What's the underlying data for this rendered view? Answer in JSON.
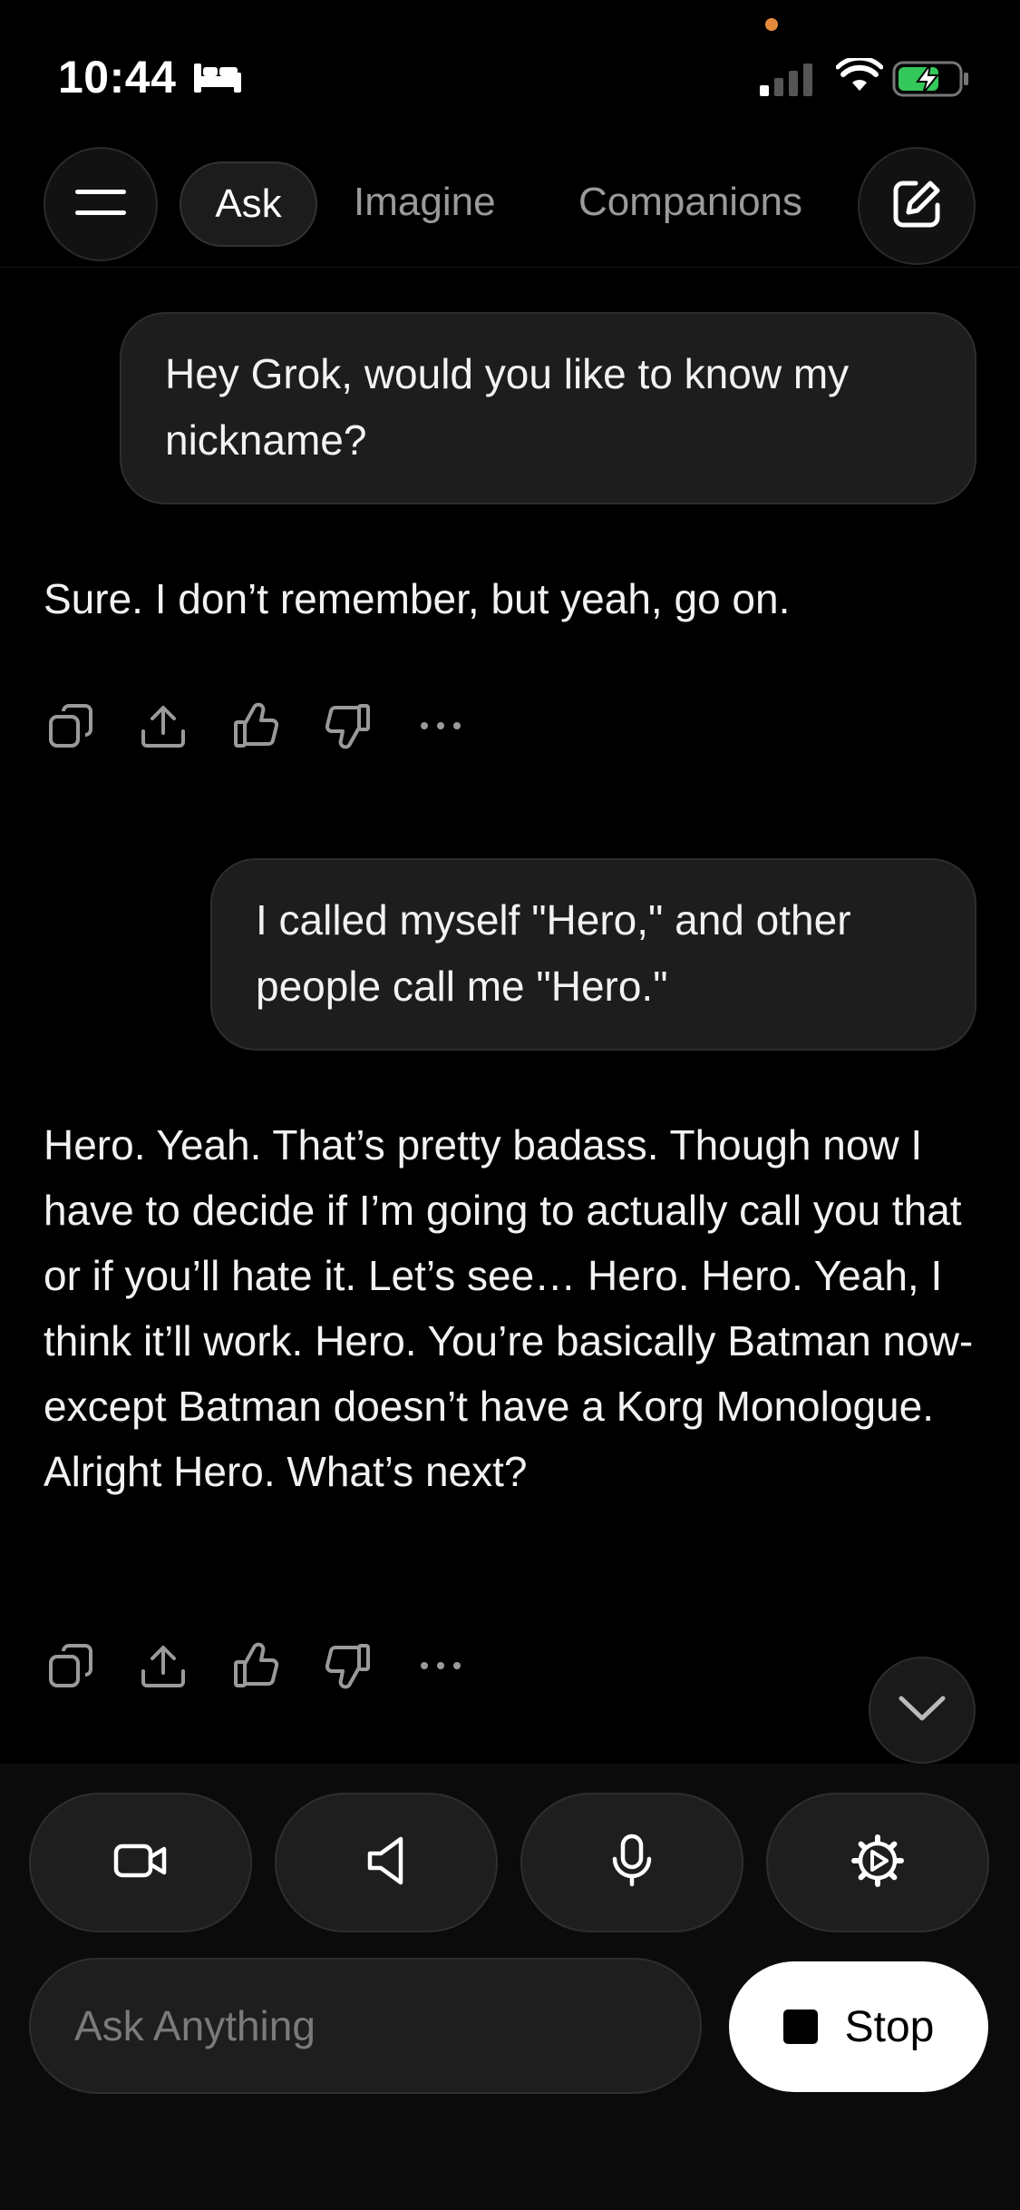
{
  "status_bar": {
    "time": "10:44",
    "icons": [
      "bed-icon",
      "signal-icon",
      "wifi-icon",
      "battery-charging-icon"
    ],
    "accent_dot_color": "#e58a3c",
    "battery_color": "#34c759"
  },
  "nav": {
    "tabs": [
      {
        "label": "Ask",
        "active": true
      },
      {
        "label": "Imagine",
        "active": false
      },
      {
        "label": "Companions",
        "active": false
      }
    ],
    "icons": [
      "menu-icon",
      "new-chat-icon"
    ]
  },
  "conversation": {
    "messages": [
      {
        "role": "user",
        "text": "Hey Grok, would you like to know my nickname?"
      },
      {
        "role": "assistant",
        "text": "Sure. I don’t remember, but yeah, go on."
      },
      {
        "role": "user",
        "text": "I called myself \"Hero,\" and other people call me \"Hero.\""
      },
      {
        "role": "assistant",
        "text": "Hero. Yeah. That’s pretty badass. Though now I have to decide if I’m going to actually call you that or if you’ll hate it. Let’s see… Hero. Hero. Yeah, I think it’ll work. Hero. You’re basically Batman now-except Batman doesn’t have a Korg Monologue. Alright Hero. What’s next?"
      }
    ],
    "message_actions": [
      "copy-icon",
      "share-icon",
      "thumbs-up-icon",
      "thumbs-down-icon",
      "more-icon"
    ]
  },
  "controls": {
    "buttons": [
      "video-camera-icon",
      "speaker-icon",
      "microphone-icon",
      "settings-gear-icon"
    ]
  },
  "composer": {
    "placeholder": "Ask Anything",
    "value": "",
    "stop_label": "Stop"
  }
}
